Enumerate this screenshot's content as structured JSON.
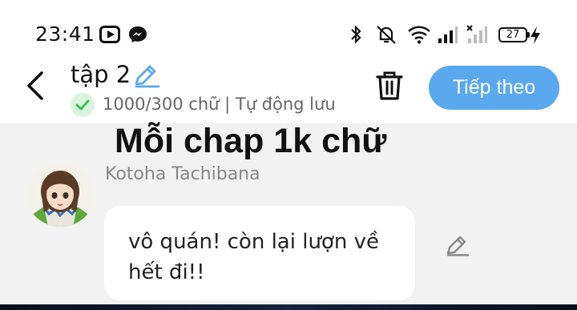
{
  "status_bar": {
    "time": "23:41",
    "left_icons": [
      "youtube-icon",
      "messenger-icon"
    ],
    "right_icons": [
      "bluetooth-icon",
      "do-not-disturb-icon",
      "wifi-icon",
      "signal-icon",
      "signal-no-service-icon",
      "charging-icon"
    ],
    "battery": "27"
  },
  "header": {
    "title": "tập 2",
    "subtitle": "1000/300 chữ | Tự động lưu",
    "next_label": "Tiếp theo",
    "accent_color": "#5aa9ef"
  },
  "content": {
    "note": "Mỗi chap 1k chữ",
    "message": {
      "character_name": "Kotoha Tachibana",
      "text": "vô quán! còn lại lượn về hết đi!!"
    }
  }
}
